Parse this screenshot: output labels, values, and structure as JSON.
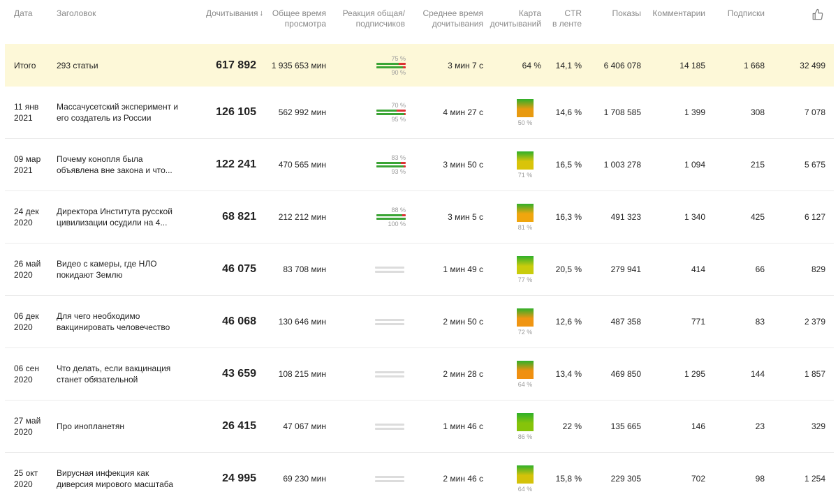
{
  "columns": {
    "date": "Дата",
    "title": "Заголовок",
    "reads": "Дочитывания",
    "sort_arrow": "↓",
    "watch_time_1": "Общее время",
    "watch_time_2": "просмотра",
    "reaction_1": "Реакция общая/",
    "reaction_2": "подписчиков",
    "avg_time_1": "Среднее время",
    "avg_time_2": "дочитывания",
    "map_1": "Карта",
    "map_2": "дочитываний",
    "ctr_1": "CTR",
    "ctr_2": "в ленте",
    "impressions": "Показы",
    "comments": "Комментарии",
    "subscriptions": "Подписки",
    "likes_icon": "thumbs-up-icon"
  },
  "total": {
    "label": "Итого",
    "title": "293 статьи",
    "reads": "617 892",
    "watch_time": "1 935 653 мин",
    "reaction_all": "75 %",
    "reaction_subs": "90 %",
    "avg_time": "3 мин 7 с",
    "map_pct": "64 %",
    "ctr": "14,1 %",
    "impressions": "6 406 078",
    "comments": "14 185",
    "subscriptions": "1 668",
    "likes": "32 499"
  },
  "rows": [
    {
      "date1": "11 янв",
      "date2": "2021",
      "title": "Массачусетский эксперимент и его создатель из России",
      "reads": "126 105",
      "watch_time": "562 992 мин",
      "reaction_all": "70 %",
      "reaction_subs": "95 %",
      "avg_time": "4 мин 27 с",
      "map_pct": "50 %",
      "map_color": "#e89a10",
      "ctr": "14,6 %",
      "impressions": "1 708 585",
      "comments": "1 399",
      "subscriptions": "308",
      "likes": "7 078"
    },
    {
      "date1": "09 мар",
      "date2": "2021",
      "title": "Почему конопля была объявлена вне закона и что...",
      "reads": "122 241",
      "watch_time": "470 565 мин",
      "reaction_all": "83 %",
      "reaction_subs": "93 %",
      "avg_time": "3 мин 50 с",
      "map_pct": "71 %",
      "map_color": "#d9c40a",
      "ctr": "16,5 %",
      "impressions": "1 003 278",
      "comments": "1 094",
      "subscriptions": "215",
      "likes": "5 675"
    },
    {
      "date1": "24 дек",
      "date2": "2020",
      "title": "Директора Института русской цивилизации осудили на 4...",
      "reads": "68 821",
      "watch_time": "212 212 мин",
      "reaction_all": "88 %",
      "reaction_subs": "100 %",
      "avg_time": "3 мин 5 с",
      "map_pct": "81 %",
      "map_color": "#f0a60e",
      "ctr": "16,3 %",
      "impressions": "491 323",
      "comments": "1 340",
      "subscriptions": "425",
      "likes": "6 127"
    },
    {
      "date1": "26 май",
      "date2": "2020",
      "title": "Видео с камеры, где НЛО покидают Землю",
      "reads": "46 075",
      "watch_time": "83 708 мин",
      "reaction_all": "",
      "reaction_subs": "",
      "avg_time": "1 мин 49 с",
      "map_pct": "77 %",
      "map_color": "#c9cc0c",
      "ctr": "20,5 %",
      "impressions": "279 941",
      "comments": "414",
      "subscriptions": "66",
      "likes": "829"
    },
    {
      "date1": "06 дек",
      "date2": "2020",
      "title": "Для чего необходимо вакцинировать человечество",
      "reads": "46 068",
      "watch_time": "130 646 мин",
      "reaction_all": "",
      "reaction_subs": "",
      "avg_time": "2 мин 50 с",
      "map_pct": "72 %",
      "map_color": "#f09512",
      "ctr": "12,6 %",
      "impressions": "487 358",
      "comments": "771",
      "subscriptions": "83",
      "likes": "2 379"
    },
    {
      "date1": "06 сен",
      "date2": "2020",
      "title": "Что делать, если вакцинация станет обязательной",
      "reads": "43 659",
      "watch_time": "108 215 мин",
      "reaction_all": "",
      "reaction_subs": "",
      "avg_time": "2 мин 28 с",
      "map_pct": "64 %",
      "map_color": "#f09010",
      "ctr": "13,4 %",
      "impressions": "469 850",
      "comments": "1 295",
      "subscriptions": "144",
      "likes": "1 857"
    },
    {
      "date1": "27 май",
      "date2": "2020",
      "title": "Про инопланетян",
      "reads": "26 415",
      "watch_time": "47 067 мин",
      "reaction_all": "",
      "reaction_subs": "",
      "avg_time": "1 мин 46 с",
      "map_pct": "86 %",
      "map_color": "#86c40a",
      "ctr": "22 %",
      "impressions": "135 665",
      "comments": "146",
      "subscriptions": "23",
      "likes": "329"
    },
    {
      "date1": "25 окт",
      "date2": "2020",
      "title": "Вирусная инфекция как диверсия мирового масштаба",
      "reads": "24 995",
      "watch_time": "69 230 мин",
      "reaction_all": "",
      "reaction_subs": "",
      "avg_time": "2 мин 46 с",
      "map_pct": "64 %",
      "map_color": "#d4c20a",
      "ctr": "15,8 %",
      "impressions": "229 305",
      "comments": "702",
      "subscriptions": "98",
      "likes": "1 254"
    }
  ]
}
